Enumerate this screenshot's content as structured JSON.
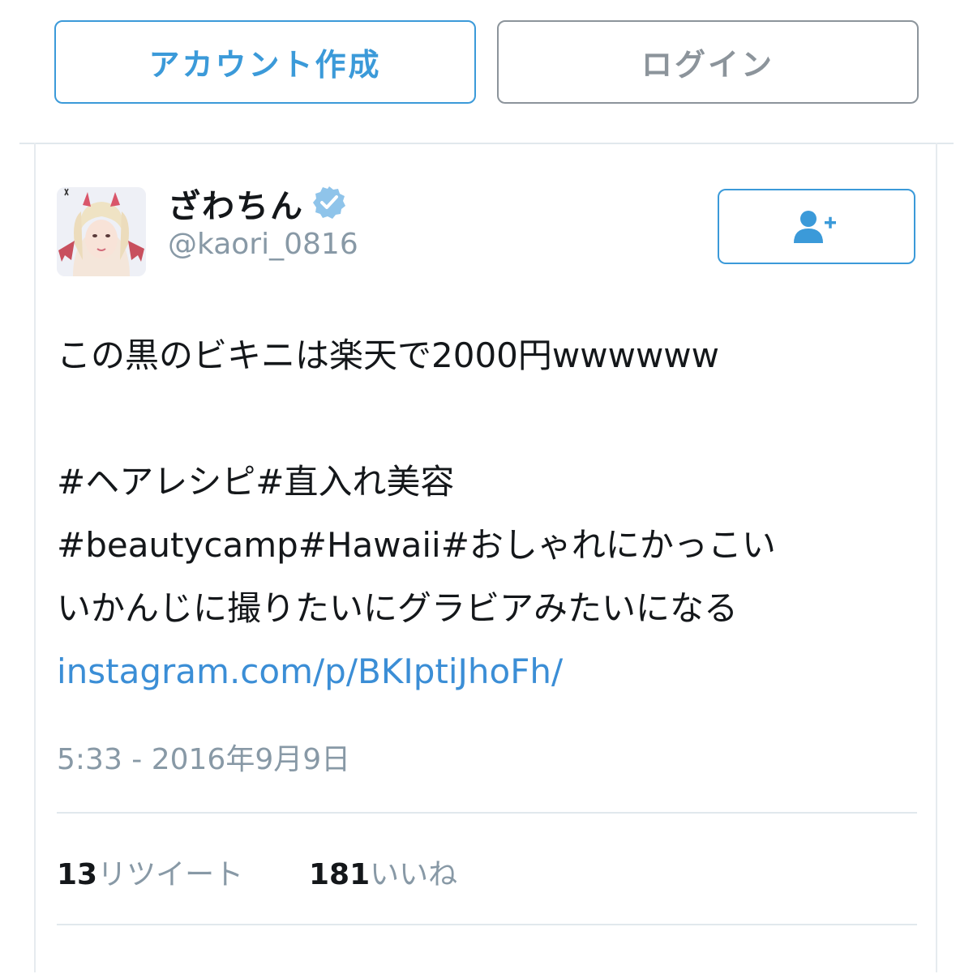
{
  "header": {
    "signup_label": "アカウント作成",
    "login_label": "ログイン"
  },
  "colors": {
    "accent": "#3b9ad9",
    "muted": "#8899a6",
    "text": "#14171a",
    "divider": "#e1e8ed"
  },
  "tweet": {
    "user": {
      "display_name": "ざわちん",
      "handle": "@kaori_0816",
      "verified": true,
      "avatar_icon": "avatar-photo"
    },
    "follow_icon": "add-user-icon",
    "text_lines": [
      "この黒のビキニは楽天で2000円wwwwww",
      "",
      "#ヘアレシピ#直入れ美容",
      "#beautycamp#Hawaii#おしゃれにかっこい",
      "いかんじに撮りたいにグラビアみたいになる"
    ],
    "link": "instagram.com/p/BKIptiJhoFh/",
    "timestamp": "5:33 - 2016年9月9日",
    "stats": {
      "retweets_count": "13",
      "retweets_label": "リツイート",
      "likes_count": "181",
      "likes_label": "いいね"
    }
  }
}
